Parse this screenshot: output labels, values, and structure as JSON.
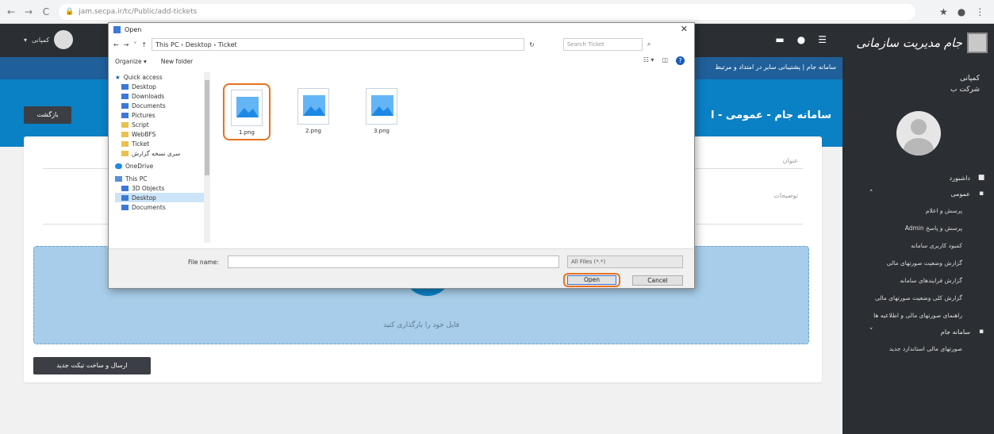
{
  "browser": {
    "url": "jam.secpa.ir/tc/Public/add-tickets",
    "nav": [
      "←",
      "→",
      "C"
    ],
    "right_icons": [
      "★",
      "●",
      "⋮"
    ]
  },
  "sidebar": {
    "logo_text": "جام مدیریت سازمانی",
    "company_line1": "کمپانی",
    "company_line2": "شرکت ب",
    "items": [
      {
        "label": "داشبورد"
      },
      {
        "label": "عمومی"
      }
    ],
    "subitems": [
      "پرسش و اعلام",
      "Admin پرسش و پاسخ",
      "کمبود کاربری سامانه",
      "گزارش وضعیت صورتهای مالی",
      "گزارش فرایندهای سامانه",
      "گزارش کلی وضعیت صورتهای مالی",
      "راهنمای صورتهای مالی و اطلاعیه ها"
    ],
    "items2": [
      {
        "label": "سامانه جام"
      }
    ],
    "subitems2": [
      "صورتهای مالی استاندارد جدید"
    ]
  },
  "topbar": {
    "user_label": "کمپانی"
  },
  "ticker": {
    "text": "سامانه جام | پشتیبانی سایر در امتداد و مرتبط"
  },
  "hero": {
    "title": "سامانه جام - عمومی - ا",
    "back_label": "بازگشت"
  },
  "form": {
    "subject_label": "عنوان",
    "desc_label": "توضیحات",
    "upload_text": "فایل خود را بارگذاری کنید",
    "submit_label": "ارسال و ساخت تیکت جدید"
  },
  "dialog": {
    "title": "Open",
    "path": "This PC  ›  Desktop  ›  Ticket",
    "search_placeholder": "Search Ticket",
    "organize": "Organize ▾",
    "new_folder": "New folder",
    "tree": [
      {
        "label": "Quick access",
        "icon": "star"
      },
      {
        "label": "Desktop",
        "icon": "blue"
      },
      {
        "label": "Downloads",
        "icon": "blue"
      },
      {
        "label": "Documents",
        "icon": "blue"
      },
      {
        "label": "Pictures",
        "icon": "blue"
      },
      {
        "label": "Script",
        "icon": "folder"
      },
      {
        "label": "WebBFS",
        "icon": "folder"
      },
      {
        "label": "Ticket",
        "icon": "folder"
      },
      {
        "label": "سری نسخه گزارش",
        "icon": "folder"
      },
      {
        "label": "OneDrive",
        "icon": "cloud"
      },
      {
        "label": "This PC",
        "icon": "pc"
      },
      {
        "label": "3D Objects",
        "icon": "blue"
      },
      {
        "label": "Desktop",
        "icon": "blue"
      },
      {
        "label": "Documents",
        "icon": "blue"
      }
    ],
    "files": [
      "1.png",
      "2.png",
      "3.png"
    ],
    "filename_label": "File name:",
    "filetype": "All Files (*.*)",
    "open_label": "Open",
    "cancel_label": "Cancel",
    "highlight_color": "#e8711f"
  }
}
